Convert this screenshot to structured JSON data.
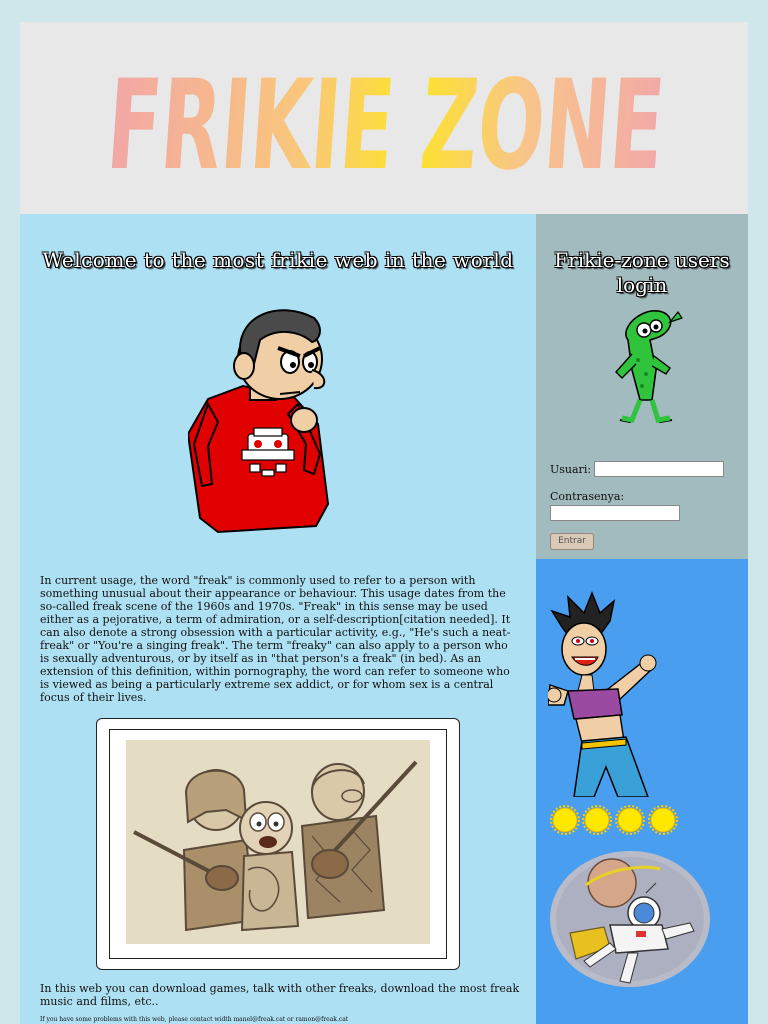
{
  "header": {
    "logo_text": "FRIKIE ZONE"
  },
  "main": {
    "welcome_title": "Welcome to the most frikie web in the world",
    "intro_text": "In current usage, the word \"freak\" is commonly used to refer to a person with something unusual about their appearance or behaviour. This usage dates from the so-called freak scene of the 1960s and 1970s. \"Freak\" in this sense may be used either as a pejorative, a term of admiration, or a self-description[citation needed]. It can also denote a strong obsession with a particular activity, e.g., \"He's such a neat-freak\" or \"You're a singing freak\". The term \"freaky\" can also apply to a person who is sexually adventurous, or by itself as in \"that person's a freak\" (in bed). As an extension of this definition, within pornography, the word can refer to someone who is viewed as being a particularly extreme sex addict, or for whom sex is a central focus of their lives.",
    "download_text": "In this web you can download games, talk with other freaks, download the most freak music and films, etc..",
    "contact_text": "If you have some problems with this web, please contact width manel@freak.cat or ramon@freak.cat"
  },
  "login": {
    "title": "Frikie-zone users login",
    "user_label": "Usuari:",
    "user_value": "",
    "password_label": "Contrasenya:",
    "password_value": "",
    "submit_label": "Entrar"
  },
  "icons": {
    "geek": "angry-geek-cartoon-icon",
    "alien": "green-alien-icon",
    "girl": "punk-girl-cartoon-icon",
    "sun": "sun-icon",
    "astronaut": "astronaut-icon"
  },
  "colors": {
    "page_bg": "#cfe6ea",
    "header_bg": "#e8e8e8",
    "main_bg": "#aee0f3",
    "login_bg": "#a1bbbf",
    "gallery_bg": "#4a9ef0",
    "logo_gradient": [
      "#f2a8a8",
      "#fde32a",
      "#f2a8a8"
    ]
  }
}
